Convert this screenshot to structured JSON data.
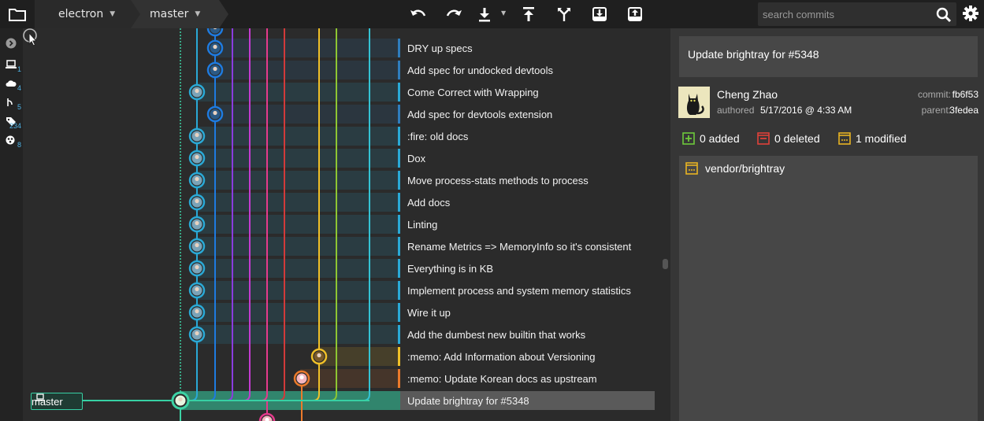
{
  "toolbar": {
    "repo_name": "electron",
    "branch_name": "master",
    "search_placeholder": "search commits",
    "icons": [
      "folder-icon",
      "undo-icon",
      "redo-icon",
      "pull-icon",
      "push-icon",
      "branch-icon",
      "stash-icon",
      "pop-icon",
      "search-icon",
      "gear-icon"
    ]
  },
  "sidebar": {
    "items": [
      {
        "icon": "expand-icon",
        "count": ""
      },
      {
        "icon": "local-icon",
        "count": "1"
      },
      {
        "icon": "remote-icon",
        "count": "4"
      },
      {
        "icon": "pull-request-icon",
        "count": "5"
      },
      {
        "icon": "tag-icon",
        "count": "234"
      },
      {
        "icon": "submodule-icon",
        "count": "8"
      }
    ]
  },
  "graph": {
    "branch_label": "master",
    "lane_colors": [
      "#3cd3a5",
      "#2aa9d6",
      "#1e7be0",
      "#8a3cdf",
      "#c33bd0",
      "#e53a8c",
      "#d23a3a",
      "#ec7a2b",
      "#f0c028",
      "#8ec632",
      "#34c3d4"
    ]
  },
  "commits": [
    {
      "message": "DRY up specs",
      "selected": false
    },
    {
      "message": "Add spec for undocked devtools",
      "selected": false
    },
    {
      "message": "Come Correct with Wrapping",
      "selected": false
    },
    {
      "message": "Add spec for devtools extension",
      "selected": false
    },
    {
      "message": ":fire: old docs",
      "selected": false
    },
    {
      "message": "Dox",
      "selected": false
    },
    {
      "message": "Move process-stats methods to process",
      "selected": false
    },
    {
      "message": "Add docs",
      "selected": false
    },
    {
      "message": "Linting",
      "selected": false
    },
    {
      "message": "Rename Metrics => MemoryInfo so it's consistent",
      "selected": false
    },
    {
      "message": "Everything is in KB",
      "selected": false
    },
    {
      "message": "Implement process and system memory statistics",
      "selected": false
    },
    {
      "message": "Wire it up",
      "selected": false
    },
    {
      "message": "Add the dumbest new builtin that works",
      "selected": false
    },
    {
      "message": ":memo: Add Information about Versioning",
      "selected": false
    },
    {
      "message": ":memo: Update Korean docs as upstream",
      "selected": false
    },
    {
      "message": "Update brightray for #5348",
      "selected": true
    }
  ],
  "detail": {
    "summary": "Update brightray for #5348",
    "author": "Cheng Zhao",
    "authored_label": "authored",
    "authored_date": "5/17/2016 @ 4:33 AM",
    "commit_label": "commit:",
    "commit_sha": "fb6f53",
    "parent_label": "parent:",
    "parent_sha": "3fedea",
    "added": "0 added",
    "deleted": "0 deleted",
    "modified": "1 modified",
    "files": [
      {
        "path": "vendor/brightray",
        "status": "modified"
      }
    ]
  },
  "colors": {
    "added": "#6ec93b",
    "deleted": "#e0413a",
    "modified": "#e8b422",
    "branch_master": "#37d0a4"
  }
}
